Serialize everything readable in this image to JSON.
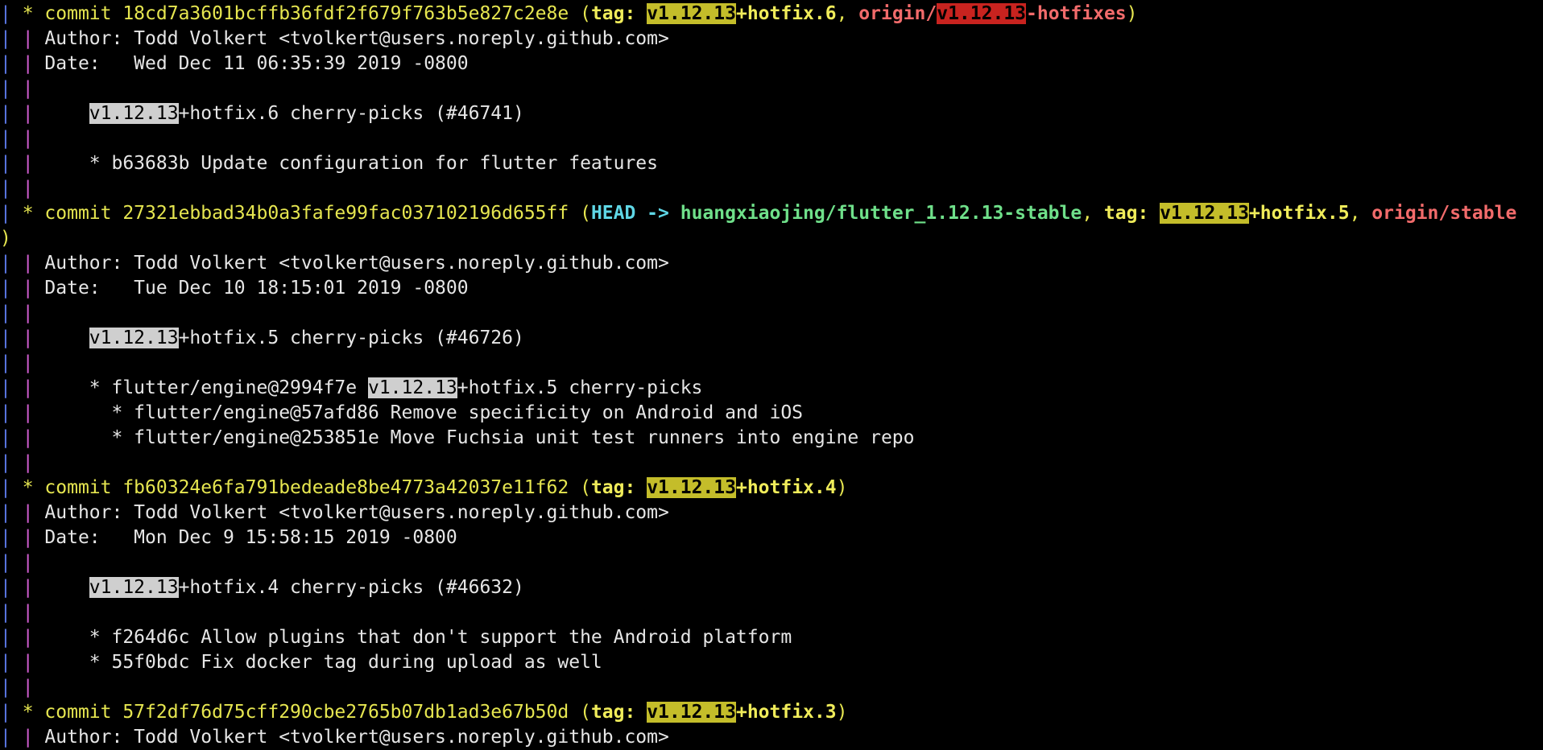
{
  "window": {
    "content": "git log --graph output"
  },
  "colors": {
    "background": "#000000",
    "default_text": "#e6e6e6",
    "commit_yellow": "#e6e650",
    "tag_highlight": "#c4bd2a",
    "branch_highlight_red": "#c8231f",
    "search_highlight_gray": "#cfcfcf",
    "head_cyan": "#5fd7e6",
    "branch_green": "#6fe08a",
    "remote_red": "#f26b6b",
    "graph_blue": "#5b78e6",
    "graph_magenta": "#d15ed1"
  },
  "lines": [
    {
      "kind": "commit",
      "segments": [
        {
          "t": "| ",
          "c": "blue"
        },
        {
          "t": "* ",
          "c": "yellow"
        },
        {
          "t": "commit 18cd7a3601bcffb36fdf2f679f763b5e827c2e8e",
          "c": "yellow"
        },
        {
          "t": " (",
          "c": "yellow"
        },
        {
          "t": "tag: ",
          "c": "yellow-bold"
        },
        {
          "t": "v1.12.13",
          "c": "yellow-bold",
          "hl": "yellow"
        },
        {
          "t": "+hotfix.6",
          "c": "yellow-bold"
        },
        {
          "t": ", ",
          "c": "yellow"
        },
        {
          "t": "origin/",
          "c": "red-bold"
        },
        {
          "t": "v1.12.13",
          "c": "red-bold",
          "hl": "red"
        },
        {
          "t": "-hotfixes",
          "c": "red-bold"
        },
        {
          "t": ")",
          "c": "yellow"
        }
      ]
    },
    {
      "kind": "author",
      "segments": [
        {
          "t": "| ",
          "c": "blue"
        },
        {
          "t": "| ",
          "c": "magenta"
        },
        {
          "t": "Author: Todd Volkert <tvolkert@users.noreply.github.com>",
          "c": "default"
        }
      ]
    },
    {
      "kind": "date",
      "segments": [
        {
          "t": "| ",
          "c": "blue"
        },
        {
          "t": "| ",
          "c": "magenta"
        },
        {
          "t": "Date:   Wed Dec 11 06:35:39 2019 -0800",
          "c": "default"
        }
      ]
    },
    {
      "kind": "blank",
      "segments": [
        {
          "t": "| ",
          "c": "blue"
        },
        {
          "t": "|",
          "c": "magenta"
        }
      ]
    },
    {
      "kind": "message",
      "segments": [
        {
          "t": "| ",
          "c": "blue"
        },
        {
          "t": "| ",
          "c": "magenta"
        },
        {
          "t": "    ",
          "c": "default"
        },
        {
          "t": "v1.12.13",
          "c": "default",
          "hl": "gray"
        },
        {
          "t": "+hotfix.6 cherry-picks (#46741)",
          "c": "default"
        }
      ]
    },
    {
      "kind": "blank",
      "segments": [
        {
          "t": "| ",
          "c": "blue"
        },
        {
          "t": "|",
          "c": "magenta"
        }
      ]
    },
    {
      "kind": "message",
      "segments": [
        {
          "t": "| ",
          "c": "blue"
        },
        {
          "t": "| ",
          "c": "magenta"
        },
        {
          "t": "    * b63683b Update configuration for flutter features",
          "c": "default"
        }
      ]
    },
    {
      "kind": "blank",
      "segments": [
        {
          "t": "| ",
          "c": "blue"
        },
        {
          "t": "|",
          "c": "magenta"
        }
      ]
    },
    {
      "kind": "commit",
      "segments": [
        {
          "t": "| ",
          "c": "blue"
        },
        {
          "t": "* ",
          "c": "yellow"
        },
        {
          "t": "commit 27321ebbad34b0a3fafe99fac037102196d655ff",
          "c": "yellow"
        },
        {
          "t": " (",
          "c": "yellow"
        },
        {
          "t": "HEAD -> ",
          "c": "cyan-bold"
        },
        {
          "t": "huangxiaojing/flutter_1.12.13-stable",
          "c": "green-bold"
        },
        {
          "t": ", ",
          "c": "yellow"
        },
        {
          "t": "tag: ",
          "c": "yellow-bold"
        },
        {
          "t": "v1.12.13",
          "c": "yellow-bold",
          "hl": "yellow"
        },
        {
          "t": "+hotfix.5",
          "c": "yellow-bold"
        },
        {
          "t": ", ",
          "c": "yellow"
        },
        {
          "t": "origin/stable",
          "c": "red-bold"
        }
      ]
    },
    {
      "kind": "wrap",
      "segments": [
        {
          "t": ")",
          "c": "yellow"
        }
      ]
    },
    {
      "kind": "author",
      "segments": [
        {
          "t": "| ",
          "c": "blue"
        },
        {
          "t": "| ",
          "c": "magenta"
        },
        {
          "t": "Author: Todd Volkert <tvolkert@users.noreply.github.com>",
          "c": "default"
        }
      ]
    },
    {
      "kind": "date",
      "segments": [
        {
          "t": "| ",
          "c": "blue"
        },
        {
          "t": "| ",
          "c": "magenta"
        },
        {
          "t": "Date:   Tue Dec 10 18:15:01 2019 -0800",
          "c": "default"
        }
      ]
    },
    {
      "kind": "blank",
      "segments": [
        {
          "t": "| ",
          "c": "blue"
        },
        {
          "t": "|",
          "c": "magenta"
        }
      ]
    },
    {
      "kind": "message",
      "segments": [
        {
          "t": "| ",
          "c": "blue"
        },
        {
          "t": "| ",
          "c": "magenta"
        },
        {
          "t": "    ",
          "c": "default"
        },
        {
          "t": "v1.12.13",
          "c": "default",
          "hl": "gray"
        },
        {
          "t": "+hotfix.5 cherry-picks (#46726)",
          "c": "default"
        }
      ]
    },
    {
      "kind": "blank",
      "segments": [
        {
          "t": "| ",
          "c": "blue"
        },
        {
          "t": "|",
          "c": "magenta"
        }
      ]
    },
    {
      "kind": "message",
      "segments": [
        {
          "t": "| ",
          "c": "blue"
        },
        {
          "t": "| ",
          "c": "magenta"
        },
        {
          "t": "    * flutter/engine@2994f7e ",
          "c": "default"
        },
        {
          "t": "v1.12.13",
          "c": "default",
          "hl": "gray"
        },
        {
          "t": "+hotfix.5 cherry-picks",
          "c": "default"
        }
      ]
    },
    {
      "kind": "message",
      "segments": [
        {
          "t": "| ",
          "c": "blue"
        },
        {
          "t": "| ",
          "c": "magenta"
        },
        {
          "t": "      * flutter/engine@57afd86 Remove specificity on Android and iOS",
          "c": "default"
        }
      ]
    },
    {
      "kind": "message",
      "segments": [
        {
          "t": "| ",
          "c": "blue"
        },
        {
          "t": "| ",
          "c": "magenta"
        },
        {
          "t": "      * flutter/engine@253851e Move Fuchsia unit test runners into engine repo",
          "c": "default"
        }
      ]
    },
    {
      "kind": "blank",
      "segments": [
        {
          "t": "| ",
          "c": "blue"
        },
        {
          "t": "|",
          "c": "magenta"
        }
      ]
    },
    {
      "kind": "commit",
      "segments": [
        {
          "t": "| ",
          "c": "blue"
        },
        {
          "t": "* ",
          "c": "yellow"
        },
        {
          "t": "commit fb60324e6fa791bedeade8be4773a42037e11f62",
          "c": "yellow"
        },
        {
          "t": " (",
          "c": "yellow"
        },
        {
          "t": "tag: ",
          "c": "yellow-bold"
        },
        {
          "t": "v1.12.13",
          "c": "yellow-bold",
          "hl": "yellow"
        },
        {
          "t": "+hotfix.4",
          "c": "yellow-bold"
        },
        {
          "t": ")",
          "c": "yellow"
        }
      ]
    },
    {
      "kind": "author",
      "segments": [
        {
          "t": "| ",
          "c": "blue"
        },
        {
          "t": "| ",
          "c": "magenta"
        },
        {
          "t": "Author: Todd Volkert <tvolkert@users.noreply.github.com>",
          "c": "default"
        }
      ]
    },
    {
      "kind": "date",
      "segments": [
        {
          "t": "| ",
          "c": "blue"
        },
        {
          "t": "| ",
          "c": "magenta"
        },
        {
          "t": "Date:   Mon Dec 9 15:58:15 2019 -0800",
          "c": "default"
        }
      ]
    },
    {
      "kind": "blank",
      "segments": [
        {
          "t": "| ",
          "c": "blue"
        },
        {
          "t": "|",
          "c": "magenta"
        }
      ]
    },
    {
      "kind": "message",
      "segments": [
        {
          "t": "| ",
          "c": "blue"
        },
        {
          "t": "| ",
          "c": "magenta"
        },
        {
          "t": "    ",
          "c": "default"
        },
        {
          "t": "v1.12.13",
          "c": "default",
          "hl": "gray"
        },
        {
          "t": "+hotfix.4 cherry-picks (#46632)",
          "c": "default"
        }
      ]
    },
    {
      "kind": "blank",
      "segments": [
        {
          "t": "| ",
          "c": "blue"
        },
        {
          "t": "|",
          "c": "magenta"
        }
      ]
    },
    {
      "kind": "message",
      "segments": [
        {
          "t": "| ",
          "c": "blue"
        },
        {
          "t": "| ",
          "c": "magenta"
        },
        {
          "t": "    * f264d6c Allow plugins that don't support the Android platform",
          "c": "default"
        }
      ]
    },
    {
      "kind": "message",
      "segments": [
        {
          "t": "| ",
          "c": "blue"
        },
        {
          "t": "| ",
          "c": "magenta"
        },
        {
          "t": "    * 55f0bdc Fix docker tag during upload as well",
          "c": "default"
        }
      ]
    },
    {
      "kind": "blank",
      "segments": [
        {
          "t": "| ",
          "c": "blue"
        },
        {
          "t": "|",
          "c": "magenta"
        }
      ]
    },
    {
      "kind": "commit",
      "segments": [
        {
          "t": "| ",
          "c": "blue"
        },
        {
          "t": "* ",
          "c": "yellow"
        },
        {
          "t": "commit 57f2df76d75cff290cbe2765b07db1ad3e67b50d",
          "c": "yellow"
        },
        {
          "t": " (",
          "c": "yellow"
        },
        {
          "t": "tag: ",
          "c": "yellow-bold"
        },
        {
          "t": "v1.12.13",
          "c": "yellow-bold",
          "hl": "yellow"
        },
        {
          "t": "+hotfix.3",
          "c": "yellow-bold"
        },
        {
          "t": ")",
          "c": "yellow"
        }
      ]
    },
    {
      "kind": "author",
      "segments": [
        {
          "t": "| ",
          "c": "blue"
        },
        {
          "t": "| ",
          "c": "magenta"
        },
        {
          "t": "Author: Todd Volkert <tvolkert@users.noreply.github.com>",
          "c": "default"
        }
      ]
    }
  ]
}
